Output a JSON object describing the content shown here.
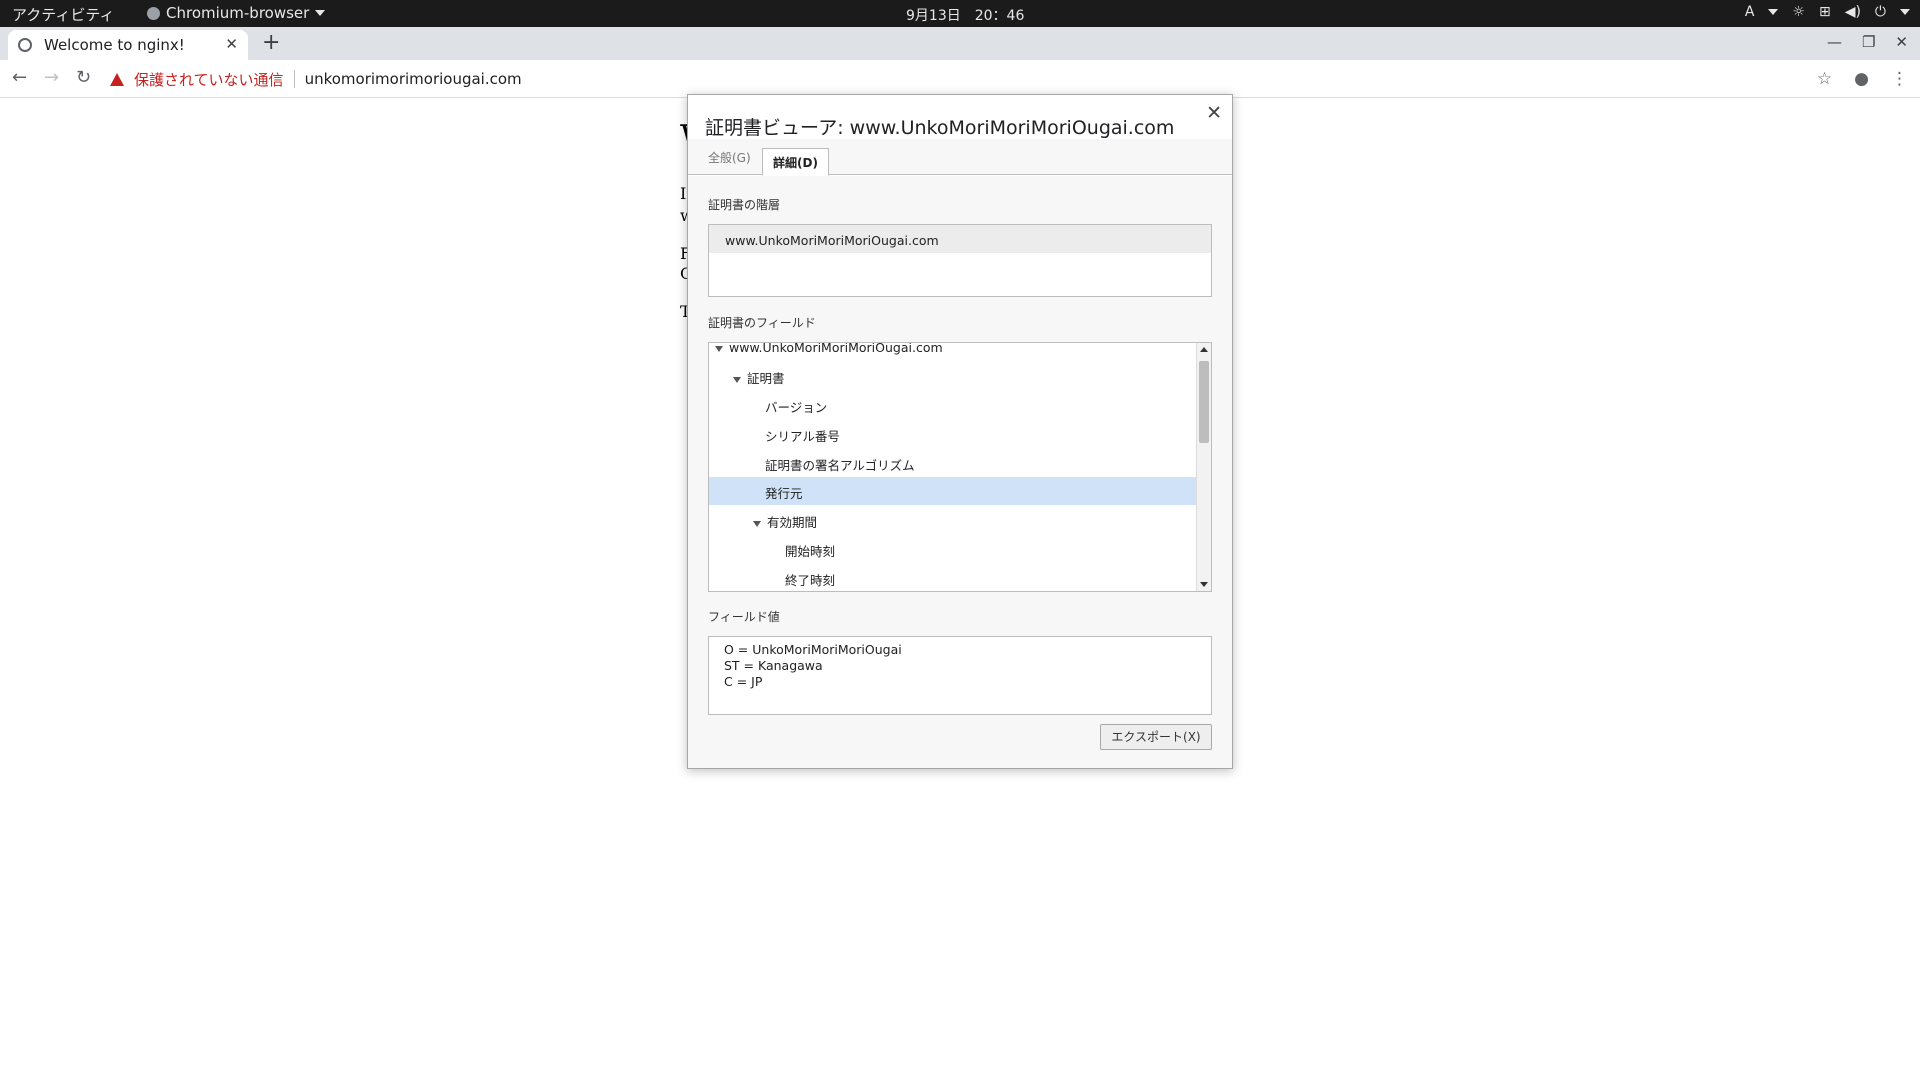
{
  "topbar": {
    "activities": "アクティビティ",
    "app_name": "Chromium-browser",
    "clock": "9月13日　20：46",
    "input_method": "A"
  },
  "browser": {
    "tab_title": "Welcome to nginx!",
    "new_tab": "+",
    "security_warning": "保護されていない通信",
    "url": "unkomorimorimoriougai.com"
  },
  "page_fragments": {
    "heading_char": "W",
    "line1": "If",
    "line2": "w",
    "line3": "F",
    "line4": "C",
    "line5": "T"
  },
  "dialog": {
    "title": "証明書ビューア: www.UnkoMoriMoriMoriOugai.com",
    "tab_general": "全般(G)",
    "tab_details": "詳細(D)",
    "hierarchy_label": "証明書の階層",
    "hierarchy_items": [
      "www.UnkoMoriMoriMoriOugai.com"
    ],
    "fields_label": "証明書のフィールド",
    "fields_tree": [
      {
        "label": "www.UnkoMoriMoriMoriOugai.com",
        "depth": 0,
        "expanded": true
      },
      {
        "label": "証明書",
        "depth": 1,
        "expanded": true
      },
      {
        "label": "バージョン",
        "depth": 2
      },
      {
        "label": "シリアル番号",
        "depth": 2
      },
      {
        "label": "証明書の署名アルゴリズム",
        "depth": 2
      },
      {
        "label": "発行元",
        "depth": 2,
        "selected": true
      },
      {
        "label": "有効期間",
        "depth": 2,
        "expanded": true
      },
      {
        "label": "開始時刻",
        "depth": 3
      },
      {
        "label": "終了時刻",
        "depth": 3
      }
    ],
    "field_value_label": "フィールド値",
    "field_value_lines": [
      "O = UnkoMoriMoriMoriOugai",
      "ST = Kanagawa",
      "C = JP"
    ],
    "export_button": "エクスポート(X)",
    "selected_color": "#cfe2f7"
  }
}
